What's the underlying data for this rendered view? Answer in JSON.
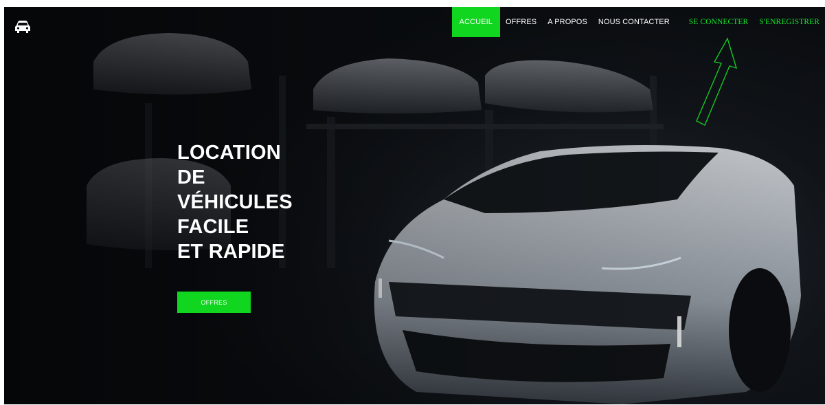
{
  "brand": {
    "logo_icon": "car-icon"
  },
  "nav": {
    "items": [
      {
        "label": "ACCUEIL",
        "active": true
      },
      {
        "label": "OFFRES",
        "active": false
      },
      {
        "label": "A PROPOS",
        "active": false
      },
      {
        "label": "NOUS CONTACTER",
        "active": false
      }
    ],
    "auth": [
      {
        "label": "SE CONNECTER"
      },
      {
        "label": "S'ENREGISTRER"
      }
    ]
  },
  "hero": {
    "title_lines": [
      "LOCATION",
      "DE",
      "VÉHICULES",
      "FACILE",
      "ET RAPIDE"
    ],
    "button_label": "OFFRES"
  },
  "colors": {
    "accent": "#10d61f",
    "accent_text": "#16e52a",
    "background": "#0d1014",
    "text": "#ffffff"
  }
}
